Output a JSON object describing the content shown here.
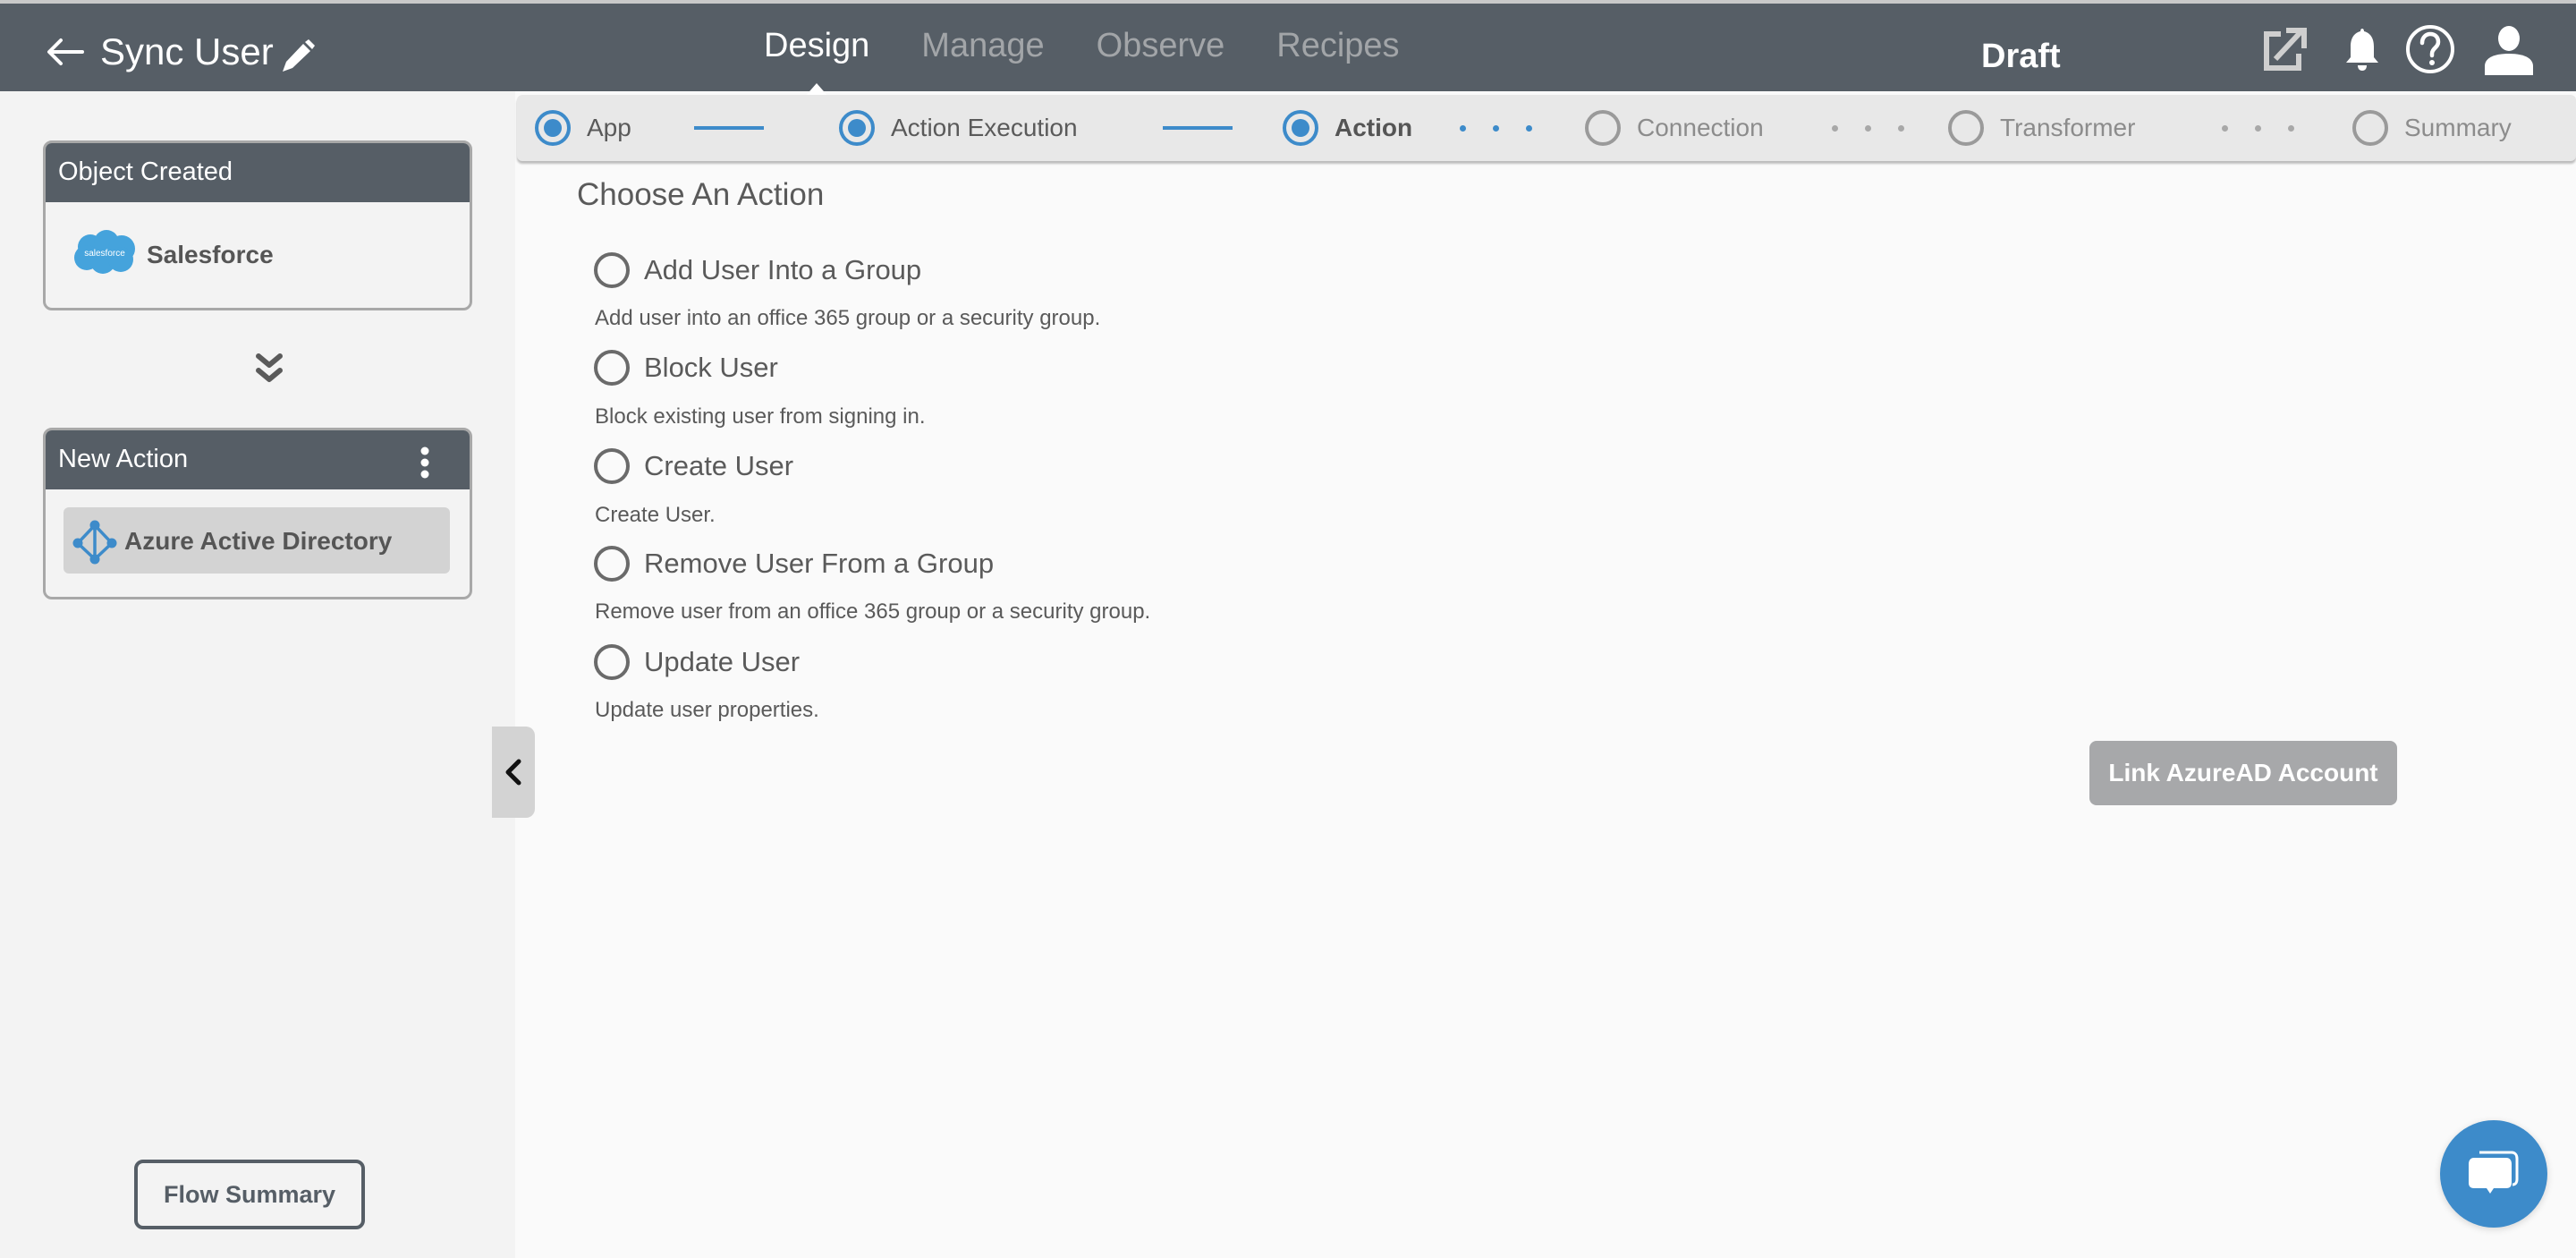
{
  "header": {
    "title": "Sync User",
    "nav_tabs": [
      {
        "label": "Design",
        "active": true
      },
      {
        "label": "Manage",
        "active": false
      },
      {
        "label": "Observe",
        "active": false
      },
      {
        "label": "Recipes",
        "active": false
      }
    ],
    "status": "Draft",
    "icons": [
      "back-arrow-icon",
      "edit-pencil-icon",
      "external-link-icon",
      "bell-icon",
      "help-icon",
      "user-icon"
    ]
  },
  "sidebar": {
    "trigger_card": {
      "title": "Object Created",
      "app": "Salesforce",
      "logo_text": "salesforce"
    },
    "action_card": {
      "title": "New Action",
      "app": "Azure Active Directory"
    },
    "flow_summary_label": "Flow Summary"
  },
  "stepper": {
    "steps": [
      {
        "label": "App",
        "state": "done"
      },
      {
        "label": "Action Execution",
        "state": "done"
      },
      {
        "label": "Action",
        "state": "current"
      },
      {
        "label": "Connection",
        "state": "pending"
      },
      {
        "label": "Transformer",
        "state": "pending"
      },
      {
        "label": "Summary",
        "state": "pending"
      }
    ]
  },
  "main": {
    "title": "Choose An Action",
    "actions": [
      {
        "label": "Add User Into a Group",
        "description": "Add user into an office 365 group or a security group.",
        "selected": false
      },
      {
        "label": "Block User",
        "description": "Block existing user from signing in.",
        "selected": false
      },
      {
        "label": "Create User",
        "description": "Create User.",
        "selected": false
      },
      {
        "label": "Remove User From a Group",
        "description": "Remove user from an office 365 group or a security group.",
        "selected": false
      },
      {
        "label": "Update User",
        "description": "Update user properties.",
        "selected": false
      }
    ],
    "link_button_label": "Link AzureAD Account"
  },
  "colors": {
    "header_bg": "#565e66",
    "accent_blue": "#3d8bca",
    "salesforce_blue": "#45a3dc",
    "button_disabled": "#a7a8aa"
  }
}
